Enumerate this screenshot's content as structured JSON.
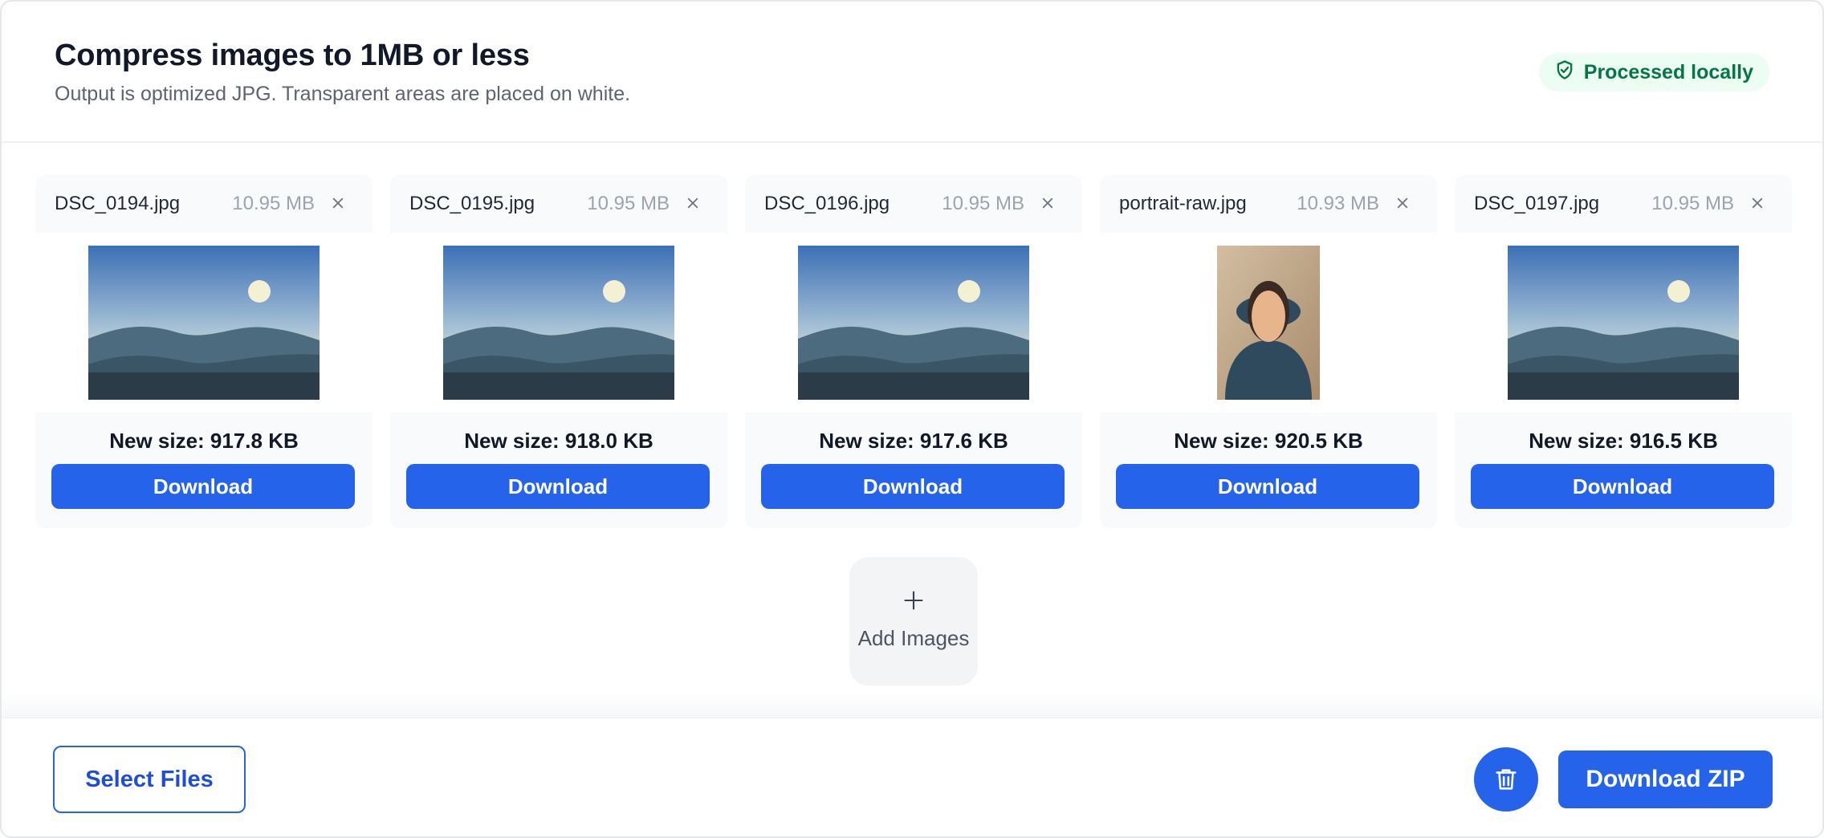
{
  "header": {
    "title": "Compress images to 1MB or less",
    "subtitle": "Output is optimized JPG. Transparent areas are placed on white.",
    "badge": {
      "label": "Processed locally",
      "icon": "shield-check-icon",
      "color": "#067647",
      "background": "#ecfdf3"
    }
  },
  "files": [
    {
      "name": "DSC_0194.jpg",
      "size": "10.95 MB",
      "new_size": "New size: 917.8 KB",
      "download_label": "Download",
      "thumbnail": "landscape"
    },
    {
      "name": "DSC_0195.jpg",
      "size": "10.95 MB",
      "new_size": "New size: 918.0 KB",
      "download_label": "Download",
      "thumbnail": "landscape"
    },
    {
      "name": "DSC_0196.jpg",
      "size": "10.95 MB",
      "new_size": "New size: 917.6 KB",
      "download_label": "Download",
      "thumbnail": "landscape"
    },
    {
      "name": "portrait-raw.jpg",
      "size": "10.93 MB",
      "new_size": "New size: 920.5 KB",
      "download_label": "Download",
      "thumbnail": "portrait"
    },
    {
      "name": "DSC_0197.jpg",
      "size": "10.95 MB",
      "new_size": "New size: 916.5 KB",
      "download_label": "Download",
      "thumbnail": "landscape"
    }
  ],
  "add_images": {
    "label": "Add Images",
    "icon": "plus-icon"
  },
  "footer": {
    "select_files_label": "Select Files",
    "clear_icon": "trash-icon",
    "download_zip_label": "Download ZIP"
  },
  "colors": {
    "accent": "#2563eb",
    "success": "#067647"
  }
}
